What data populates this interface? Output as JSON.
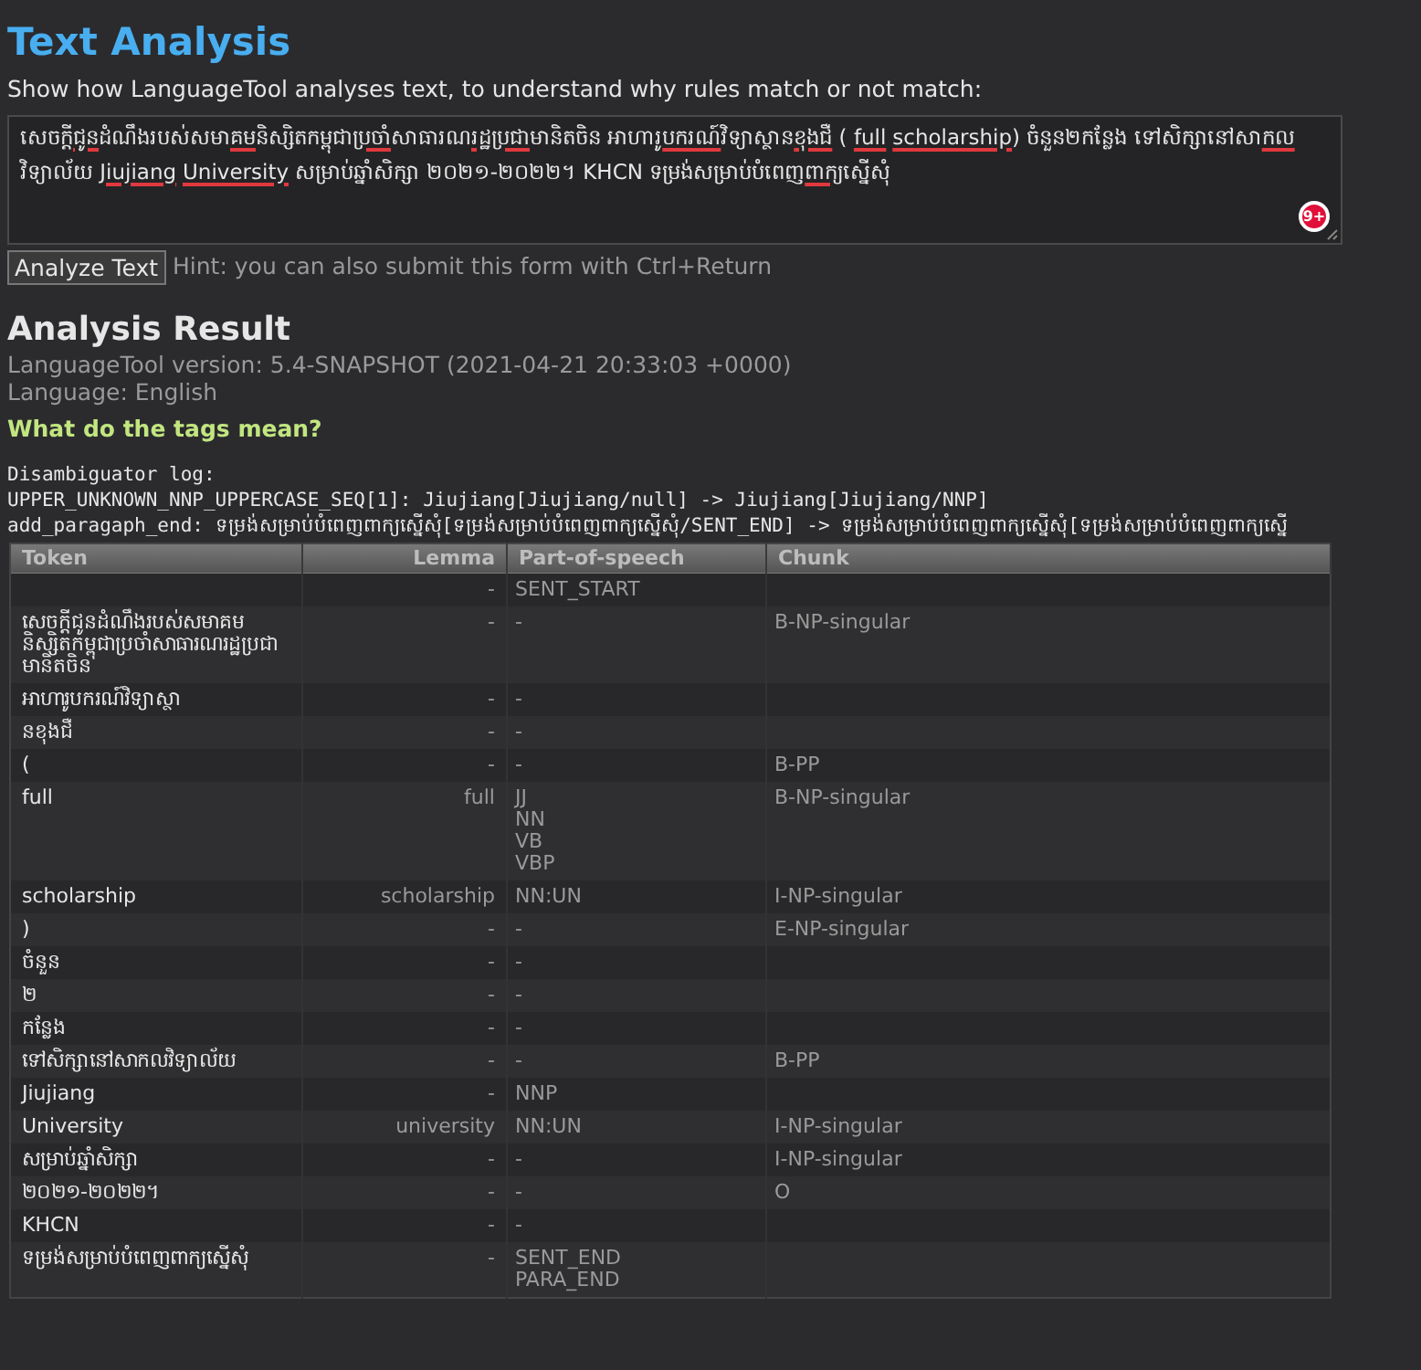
{
  "title": "Text Analysis",
  "intro": "Show how LanguageTool analyses text, to understand why rules match or not match:",
  "input": {
    "segments": [
      {
        "text": "សេចក្តី",
        "flagged": false
      },
      {
        "text": "ជូន",
        "flagged": true
      },
      {
        "text": "ដំណឹងរបស់សមា",
        "flagged": false
      },
      {
        "text": "គម",
        "flagged": true
      },
      {
        "text": "និស្សិតកម្ពុជា",
        "flagged": false
      },
      {
        "text": "ប្រចាំ",
        "flagged": true
      },
      {
        "text": "សាធារណ",
        "flagged": false
      },
      {
        "text": "រដ្ឋប្រជា",
        "flagged": true
      },
      {
        "text": "មានិតចិន ",
        "flagged": false
      },
      {
        "text": "អាហារូ",
        "flagged": false
      },
      {
        "text": "បករណ៍",
        "flagged": true
      },
      {
        "text": "វិទ្យាស្ថាន",
        "flagged": false
      },
      {
        "text": "ខុងជឺ",
        "flagged": true
      },
      {
        "text": " ( ",
        "flagged": false
      },
      {
        "text": "full",
        "flagged": true
      },
      {
        "text": "scholarship",
        "flagged": true,
        "gap_before": true
      },
      {
        "text": ") ចំនួន២កន្លែង ទៅសិក្សានៅសា",
        "flagged": false
      },
      {
        "text": "កល",
        "flagged": true
      },
      {
        "text": "វិទ្យាល័យ ",
        "flagged": false
      },
      {
        "text": "Jiujiang",
        "flagged": true
      },
      {
        "text": "University",
        "flagged": true,
        "gap_before": true
      },
      {
        "text": " សម្រាប់ឆ្នាំសិក្សា ២០២១-២០២២។ KHCN ទម្រង់សម្រាប់បំពេញ",
        "flagged": false
      },
      {
        "text": "ពាក្យ",
        "flagged": true
      },
      {
        "text": "ស្នើសុំ",
        "flagged": false
      }
    ],
    "badge": "9+"
  },
  "analyze_button": "Analyze Text",
  "hint": "Hint: you can also submit this form with Ctrl+Return",
  "result_title": "Analysis Result",
  "version": "LanguageTool version: 5.4-SNAPSHOT (2021-04-21 20:33:03 +0000)",
  "language": "Language: English",
  "tags_link": "What do the tags mean?",
  "log": [
    "Disambiguator log:",
    "UPPER_UNKNOWN_NNP_UPPERCASE_SEQ[1]: Jiujiang[Jiujiang/null] -> Jiujiang[Jiujiang/NNP]",
    "add_paragaph_end: ទម្រង់សម្រាប់បំពេញពាក្យស្នើសុំ[ទម្រង់សម្រាប់បំពេញពាក្យស្នើសុំ/SENT_END] -> ទម្រង់សម្រាប់បំពេញពាក្យស្នើសុំ[ទម្រង់សម្រាប់បំពេញពាក្យស្នើ"
  ],
  "table": {
    "columns": [
      "Token",
      "Lemma",
      "Part-of-speech",
      "Chunk"
    ],
    "rows": [
      {
        "token": "",
        "lemma": "-",
        "pos": [
          "SENT_START"
        ],
        "chunk": ""
      },
      {
        "token": "សេចក្តីជូនដំណឹងរបស់សមាគមនិស្សិតកម្ពុជាប្រចាំសាធារណរដ្ឋប្រជាមានិតចិន",
        "lemma": "-",
        "pos": [
          "-"
        ],
        "chunk": "B-NP-singular"
      },
      {
        "token": "អាហារូបករណ៍វិទ្យាស្ថា",
        "lemma": "-",
        "pos": [
          "-"
        ],
        "chunk": ""
      },
      {
        "token": "នខុងជឺ",
        "lemma": "-",
        "pos": [
          "-"
        ],
        "chunk": ""
      },
      {
        "token": "(",
        "lemma": "-",
        "pos": [
          "-"
        ],
        "chunk": "B-PP"
      },
      {
        "token": "full",
        "lemma": "full",
        "pos": [
          "JJ",
          "NN",
          "VB",
          "VBP"
        ],
        "chunk": "B-NP-singular"
      },
      {
        "token": "scholarship",
        "lemma": "scholarship",
        "pos": [
          "NN:UN"
        ],
        "chunk": "I-NP-singular"
      },
      {
        "token": ")",
        "lemma": "-",
        "pos": [
          "-"
        ],
        "chunk": "E-NP-singular"
      },
      {
        "token": "ចំនួន",
        "lemma": "-",
        "pos": [
          "-"
        ],
        "chunk": ""
      },
      {
        "token": "២",
        "lemma": "-",
        "pos": [
          "-"
        ],
        "chunk": ""
      },
      {
        "token": "កន្លែង",
        "lemma": "-",
        "pos": [
          "-"
        ],
        "chunk": ""
      },
      {
        "token": "ទៅសិក្សានៅសាកលវិទ្យាល័យ",
        "lemma": "-",
        "pos": [
          "-"
        ],
        "chunk": "B-PP"
      },
      {
        "token": "Jiujiang",
        "lemma": "-",
        "pos": [
          "NNP"
        ],
        "chunk": ""
      },
      {
        "token": "University",
        "lemma": "university",
        "pos": [
          "NN:UN"
        ],
        "chunk": "I-NP-singular"
      },
      {
        "token": "សម្រាប់ឆ្នាំសិក្សា",
        "lemma": "-",
        "pos": [
          "-"
        ],
        "chunk": "I-NP-singular"
      },
      {
        "token": "២០២១-២០២២។",
        "lemma": "-",
        "pos": [
          "-"
        ],
        "chunk": "O"
      },
      {
        "token": "KHCN",
        "lemma": "-",
        "pos": [
          "-"
        ],
        "chunk": ""
      },
      {
        "token": "ទម្រង់សម្រាប់បំពេញពាក្យស្នើសុំ",
        "lemma": "-",
        "pos": [
          "SENT_END",
          "PARA_END"
        ],
        "chunk": ""
      }
    ]
  }
}
